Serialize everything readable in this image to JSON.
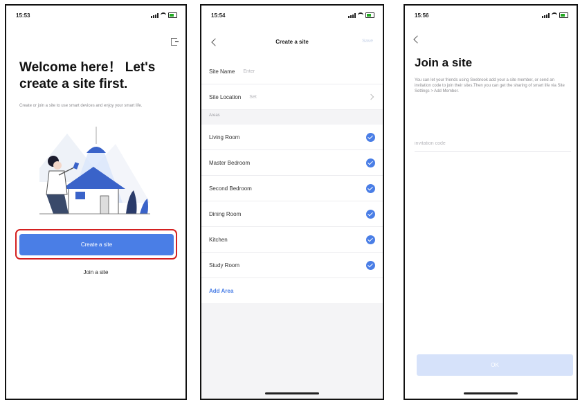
{
  "phone1": {
    "time": "15:53",
    "title": "Welcome here！ Let's create a site first.",
    "subtitle": "Create or join a site to use smart devices and enjoy your smart life.",
    "create_button": "Create a site",
    "join_link": "Join a site"
  },
  "phone2": {
    "time": "15:54",
    "title": "Create a site",
    "save": "Save",
    "site_name_label": "Site Name",
    "site_name_placeholder": "Enter",
    "site_location_label": "Site Location",
    "site_location_value": "Set",
    "areas_label": "Areas",
    "areas": [
      {
        "name": "Living Room",
        "checked": true
      },
      {
        "name": "Master Bedroom",
        "checked": true
      },
      {
        "name": "Second Bedroom",
        "checked": true
      },
      {
        "name": "Dining Room",
        "checked": true
      },
      {
        "name": "Kitchen",
        "checked": true
      },
      {
        "name": "Study Room",
        "checked": true
      }
    ],
    "add_area": "Add Area"
  },
  "phone3": {
    "time": "15:56",
    "title": "Join a site",
    "description": "You can let your friends using Seebrook add your a site member, or send an invitation code to join their sites.Then you can get the sharing of smart life via Site Settings > Add Member.",
    "code_placeholder": "invitation code",
    "ok_button": "OK"
  },
  "colors": {
    "accent": "#4a7ee6",
    "highlight": "#d42020",
    "disabled": "#d6e2fa"
  }
}
